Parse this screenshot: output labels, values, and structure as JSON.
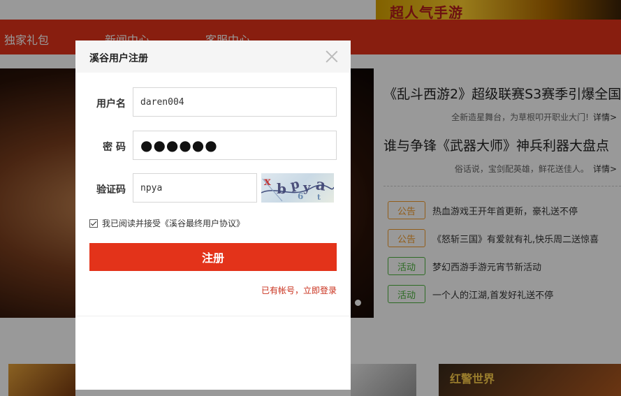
{
  "background": {
    "top_ad_text": "超人气手游",
    "nav": [
      "独家礼包",
      "新闻中心",
      "客服中心"
    ],
    "news": [
      {
        "headline": "《乱斗西游2》超级联赛S3赛季引爆全国",
        "summary": "全新造星舞台，为草根叩开职业大门!",
        "more": "详情>"
      },
      {
        "headline": "谁与争锋《武器大师》神兵利器大盘点",
        "summary": "俗话说，宝剑配英雄，鲜花送佳人。",
        "more": "详情>"
      }
    ],
    "notices": [
      {
        "tag": "公告",
        "color": "#f39b2a",
        "text": "热血游戏王开年首更新，豪礼送不停"
      },
      {
        "tag": "公告",
        "color": "#f39b2a",
        "text": "《怒斩三国》有爱就有礼,快乐周二送惊喜"
      },
      {
        "tag": "活动",
        "color": "#4cb33d",
        "text": "梦幻西游手游元宵节新活动"
      },
      {
        "tag": "活动",
        "color": "#4cb33d",
        "text": "一个人的江湖,首发好礼送不停"
      }
    ],
    "thumb_text": "红警世界"
  },
  "dialog": {
    "title": "溪谷用户注册",
    "username_label": "用户名",
    "username_value": "daren004",
    "password_label": "密 码",
    "password_mask": "●●●●●●",
    "captcha_label": "验证码",
    "captcha_value": "npya",
    "agree_text": "我已阅读并接受《溪谷最终用户协议》",
    "agree_checked": true,
    "submit_label": "注册",
    "login_link": "已有帐号，立即登录"
  },
  "colors": {
    "brand_red": "#e3331a",
    "link_red": "#c9301c",
    "tag_orange": "#f39b2a",
    "tag_green": "#4cb33d"
  }
}
